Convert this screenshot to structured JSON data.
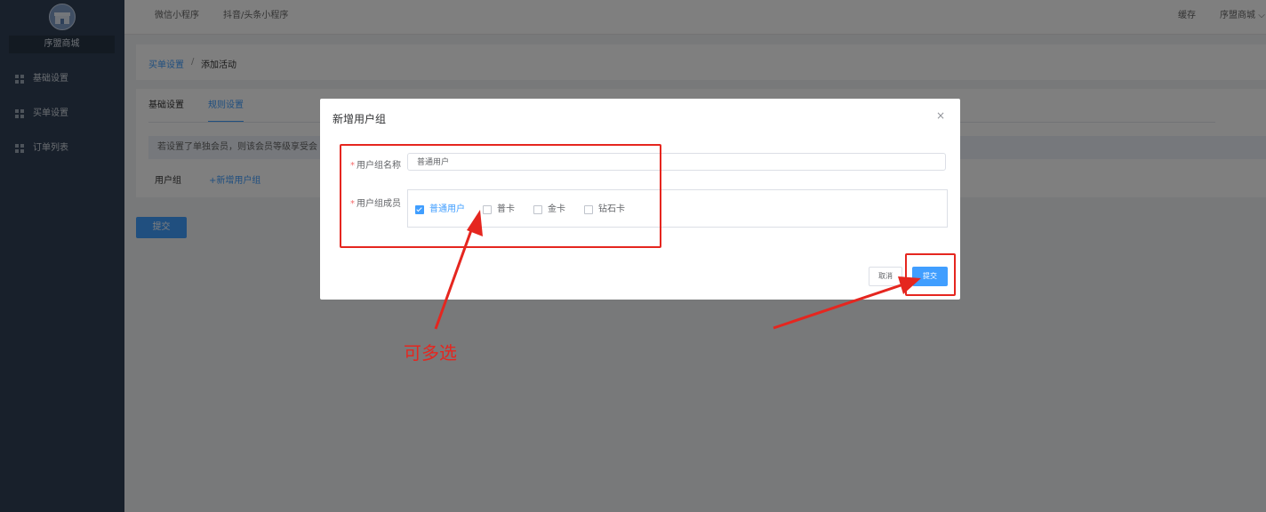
{
  "sidebar": {
    "store_name": "序盟商城",
    "items": [
      {
        "label": "基础设置",
        "icon": "grid-icon"
      },
      {
        "label": "买单设置",
        "icon": "grid-icon"
      },
      {
        "label": "订单列表",
        "icon": "grid-icon"
      }
    ]
  },
  "topbar": {
    "links": [
      "微信小程序",
      "抖音/头条小程序"
    ],
    "cache_label": "缓存",
    "user_label": "序盟商城"
  },
  "breadcrumb": {
    "parent": "买单设置",
    "separator": "/",
    "current": "添加活动"
  },
  "tabs": [
    {
      "label": "基础设置",
      "active": false
    },
    {
      "label": "规则设置",
      "active": true
    }
  ],
  "notice": "若设置了单独会员，则该会员等级享受会",
  "user_group_label": "用户组",
  "add_group_link": "+新增用户组",
  "submit_label": "提交",
  "dialog": {
    "title": "新增用户组",
    "close_icon": "×",
    "name_label": "用户组名称",
    "name_value": "普通用户",
    "members_label": "用户组成员",
    "members": [
      {
        "label": "普通用户",
        "checked": true
      },
      {
        "label": "普卡",
        "checked": false
      },
      {
        "label": "金卡",
        "checked": false
      },
      {
        "label": "钻石卡",
        "checked": false
      }
    ],
    "cancel_label": "取消",
    "submit_label": "提交"
  },
  "annotation": {
    "text": "可多选",
    "color": "#e5261f"
  },
  "colors": {
    "accent": "#409eff",
    "sidebar_bg": "#304156",
    "annotation": "#e5261f"
  }
}
